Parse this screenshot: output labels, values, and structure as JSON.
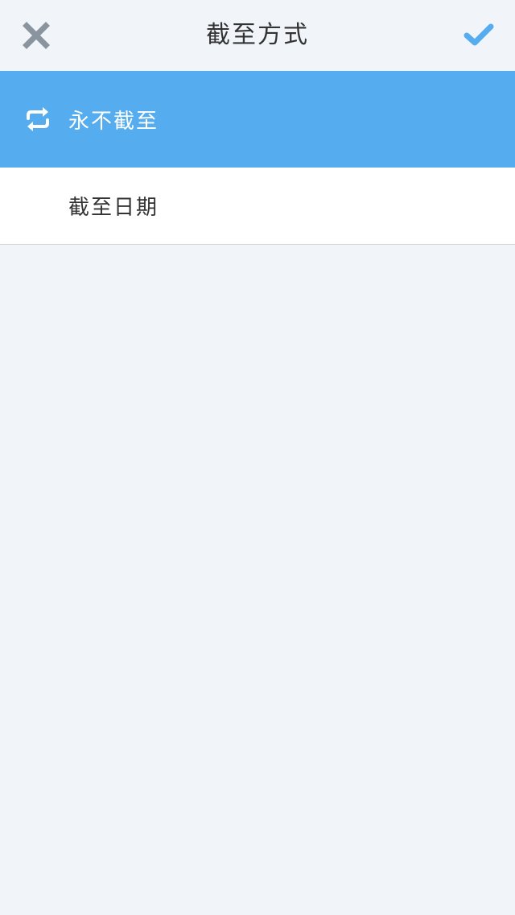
{
  "header": {
    "title": "截至方式",
    "close_icon": "close-icon",
    "confirm_icon": "checkmark-icon"
  },
  "options": [
    {
      "label": "永不截至",
      "icon": "repeat-icon",
      "selected": true
    },
    {
      "label": "截至日期",
      "icon": "",
      "selected": false
    }
  ],
  "colors": {
    "accent": "#55acee",
    "background": "#f1f5f9",
    "close_icon": "#8a949e",
    "title_text": "#333333"
  }
}
